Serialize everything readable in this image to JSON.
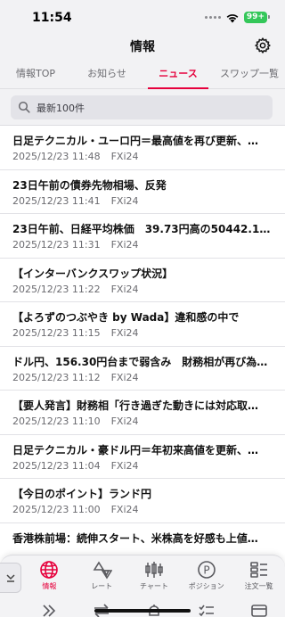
{
  "status_bar": {
    "time": "11:54",
    "battery": "99+"
  },
  "header": {
    "title": "情報"
  },
  "tabs": [
    {
      "label": "情報TOP",
      "active": false
    },
    {
      "label": "お知らせ",
      "active": false
    },
    {
      "label": "ニュース",
      "active": true
    },
    {
      "label": "スワップ一覧",
      "active": false
    }
  ],
  "search": {
    "placeholder": "最新100件"
  },
  "news": [
    {
      "title": "日足テクニカル・ユーロ円＝最高値を再び更新、…",
      "datetime": "2025/12/23 11:48",
      "source": "FXi24"
    },
    {
      "title": "23日午前の債券先物相場、反発",
      "datetime": "2025/12/23 11:41",
      "source": "FXi24"
    },
    {
      "title": "23日午前、日経平均株価　39.73円高の50442.12円",
      "datetime": "2025/12/23 11:31",
      "source": "FXi24"
    },
    {
      "title": "【インターバンクスワップ状況】",
      "datetime": "2025/12/23 11:22",
      "source": "FXi24"
    },
    {
      "title": "【よろずのつぶやき by Wada】違和感の中で",
      "datetime": "2025/12/23 11:15",
      "source": "FXi24"
    },
    {
      "title": "ドル円、156.30円台まで弱含み　財務相が再び為…",
      "datetime": "2025/12/23 11:12",
      "source": "FXi24"
    },
    {
      "title": "【要人発言】財務相「行き過ぎた動きには対応取…",
      "datetime": "2025/12/23 11:10",
      "source": "FXi24"
    },
    {
      "title": "日足テクニカル・豪ドル円＝年初来高値を更新、…",
      "datetime": "2025/12/23 11:04",
      "source": "FXi24"
    },
    {
      "title": "【今日のポイント】ランド円",
      "datetime": "2025/12/23 11:00",
      "source": "FXi24"
    },
    {
      "title": "香港株前場：続伸スタート、米株高を好感も上値…",
      "datetime": "",
      "source": ""
    }
  ],
  "bottom_nav": [
    {
      "label": "情報",
      "icon": "globe-icon",
      "active": true
    },
    {
      "label": "レート",
      "icon": "rate-icon",
      "active": false
    },
    {
      "label": "チャート",
      "icon": "chart-icon",
      "active": false
    },
    {
      "label": "ポジション",
      "icon": "position-icon",
      "active": false
    },
    {
      "label": "注文一覧",
      "icon": "order-list-icon",
      "active": false
    }
  ],
  "colors": {
    "accent": "#e6003c",
    "battery": "#34c759"
  }
}
